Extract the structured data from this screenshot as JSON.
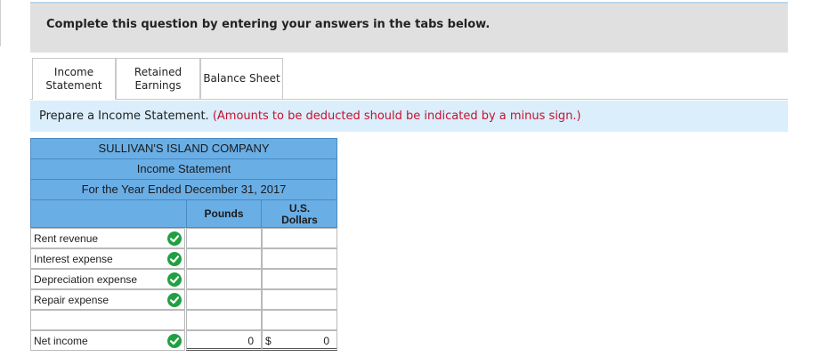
{
  "banner": {
    "text": "Complete this question by entering your answers in the tabs below."
  },
  "tabs": [
    {
      "line1": "Income",
      "line2": "Statement"
    },
    {
      "line1": "Retained",
      "line2": "Earnings"
    },
    {
      "line1": "Balance Sheet",
      "line2": ""
    }
  ],
  "instruction": {
    "prefix": "Prepare a Income Statement. ",
    "note": "(Amounts to be deducted should be indicated by a minus sign.)"
  },
  "statement": {
    "company": "SULLIVAN'S ISLAND COMPANY",
    "title": "Income Statement",
    "period": "For the Year Ended December 31, 2017",
    "col_pounds": "Pounds",
    "col_usd_line1": "U.S.",
    "col_usd_line2": "Dollars",
    "rows": [
      {
        "label": "Rent revenue",
        "pounds": "",
        "usd": ""
      },
      {
        "label": "Interest expense",
        "pounds": "",
        "usd": ""
      },
      {
        "label": "Depreciation expense",
        "pounds": "",
        "usd": ""
      },
      {
        "label": "Repair expense",
        "pounds": "",
        "usd": ""
      },
      {
        "label": "",
        "pounds": "",
        "usd": ""
      },
      {
        "label": "Net income",
        "pounds": "0",
        "usd_symbol": "$",
        "usd": "0"
      }
    ]
  },
  "colors": {
    "header_blue": "#6aaee6",
    "check_green": "#21a043",
    "note_red": "#c8102e",
    "instr_bg": "#daeefc"
  }
}
